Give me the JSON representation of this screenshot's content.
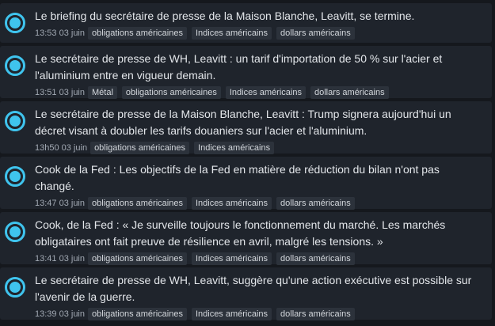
{
  "news": [
    {
      "lines": [
        "Le briefing du secrétaire de presse de la Maison Blanche, Leavitt, se termine."
      ],
      "time": "13:53 03 juin",
      "tags": [
        "obligations américaines",
        "Indices américains",
        "dollars américains"
      ]
    },
    {
      "lines": [
        "Le secrétaire de presse de WH, Leavitt : un tarif d'importation de 50 % sur l'acier et",
        "l'aluminium entre en vigueur demain."
      ],
      "time": "13:51 03 juin",
      "tags": [
        "Métal",
        "obligations américaines",
        "Indices américains",
        "dollars américains"
      ]
    },
    {
      "lines": [
        "Le secrétaire de presse de la Maison Blanche, Leavitt : Trump signera aujourd'hui un",
        "décret visant à doubler les tarifs douaniers sur l'acier et l'aluminium."
      ],
      "time": "13h50 03 juin",
      "tags": [
        "obligations américaines",
        "Indices américains"
      ]
    },
    {
      "lines": [
        "Cook de la Fed : Les objectifs de la Fed en matière de réduction du bilan n'ont pas",
        "changé."
      ],
      "time": "13:47 03 juin",
      "tags": [
        "obligations américaines",
        "Indices américains",
        "dollars américains"
      ]
    },
    {
      "lines": [
        "Cook, de la Fed : « Je surveille toujours le fonctionnement du marché. Les marchés",
        "obligataires ont fait preuve de résilience en avril, malgré les tensions. »"
      ],
      "time": "13:41 03 juin",
      "tags": [
        "obligations américaines",
        "Indices américains",
        "dollars américains"
      ]
    },
    {
      "lines": [
        "Le secrétaire de presse de WH, Leavitt, suggère qu'une action exécutive est possible sur",
        "l'avenir de la guerre."
      ],
      "time": "13:39 03 juin",
      "tags": [
        "obligations américaines",
        "Indices américains",
        "dollars américains"
      ]
    }
  ],
  "colors": {
    "accent": "#3fc4ee",
    "card": "#1f242c",
    "background": "#15181d",
    "headline": "#e3e6ea",
    "tag_bg": "#2c323b"
  },
  "icons": {
    "bullet": "radio-dot-icon"
  }
}
